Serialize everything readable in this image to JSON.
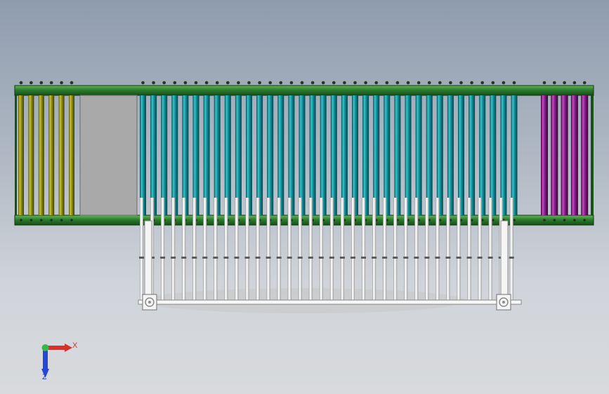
{
  "view": {
    "type": "cad-top-view",
    "background_top": "#8f9cae",
    "background_bottom": "#d8dadd"
  },
  "conveyor": {
    "frame_color": "#1d6a1f",
    "frame_highlight": "#4f9d43",
    "left_roller_color": "#a4a118",
    "middle_roller_color": "#139aa2",
    "right_roller_color": "#8f1e8f",
    "left_roller_count": 6,
    "middle_roller_count": 36,
    "right_roller_count": 5,
    "gap_panel_color": "#a9a9a9"
  },
  "underframe": {
    "rod_count": 36,
    "rod_color": "#f4f4f4",
    "outline_color": "#7a7a7a"
  },
  "axes": {
    "x_label": "X",
    "z_label": "Z",
    "x_color": "#d6302d",
    "z_color": "#2646d8",
    "origin_color": "#39b54a"
  }
}
